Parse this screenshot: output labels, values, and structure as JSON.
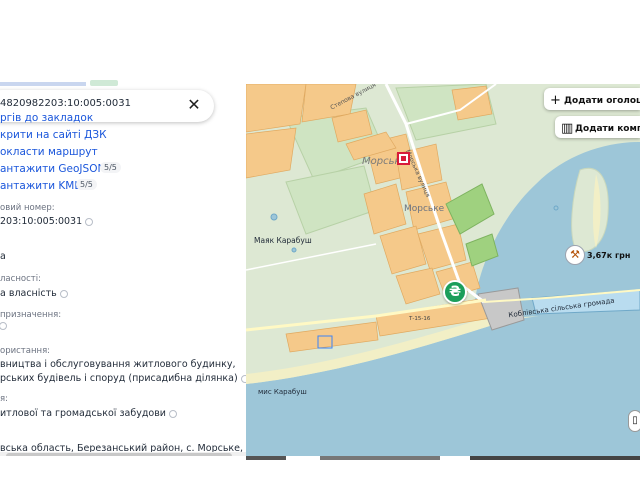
{
  "panel": {
    "search_value": "4820982203:10:005:0031",
    "close_icon": "close-icon",
    "links": [
      {
        "label": "ргів до закладок"
      },
      {
        "label": "крити на сайті ДЗК"
      },
      {
        "label": "окласти маршрут"
      },
      {
        "label": "антажити GeoJSON",
        "count": "5/5"
      },
      {
        "label": "антажити KML",
        "count": "5/5"
      }
    ],
    "fields": [
      {
        "label": "овий номер:",
        "value": "203:10:005:0031"
      },
      {
        "label": "",
        "value": "а"
      },
      {
        "label": "ласності:",
        "value": "а власність"
      },
      {
        "label": "призначення:",
        "value": ""
      },
      {
        "label": "ористання:",
        "value_lines": [
          "вництва і обслуговування житлового будинку,",
          "рських будівель і споруд (присадибна ділянка)"
        ]
      },
      {
        "label": "я:",
        "value": "итлової та громадської забудови"
      },
      {
        "label": "",
        "value": "вська область, Березанський район, с. Морське,"
      }
    ]
  },
  "map": {
    "buttons": {
      "add_listing": "Додати оголошення",
      "add_company": "Додати компанію"
    },
    "labels": {
      "village_main": "Морське",
      "village_center": "Морське",
      "street": "Степова вулиця",
      "street2": "Морська вулиця",
      "lighthouse": "Маяк Карабуш",
      "cape": "мис Карабуш",
      "community": "Коблівська сільська громада",
      "road_ref": "Т-15-16"
    },
    "price": "3,67к грн",
    "currency_symbol": "₴",
    "colors": {
      "water": "#9dc6d8",
      "land": "#dde8d3",
      "parcel": "#f5c98a",
      "parcel_stroke": "#e0a960",
      "road": "#ffffff",
      "accent_green": "#1b9e5a",
      "marker_red": "#d81b3a"
    }
  }
}
